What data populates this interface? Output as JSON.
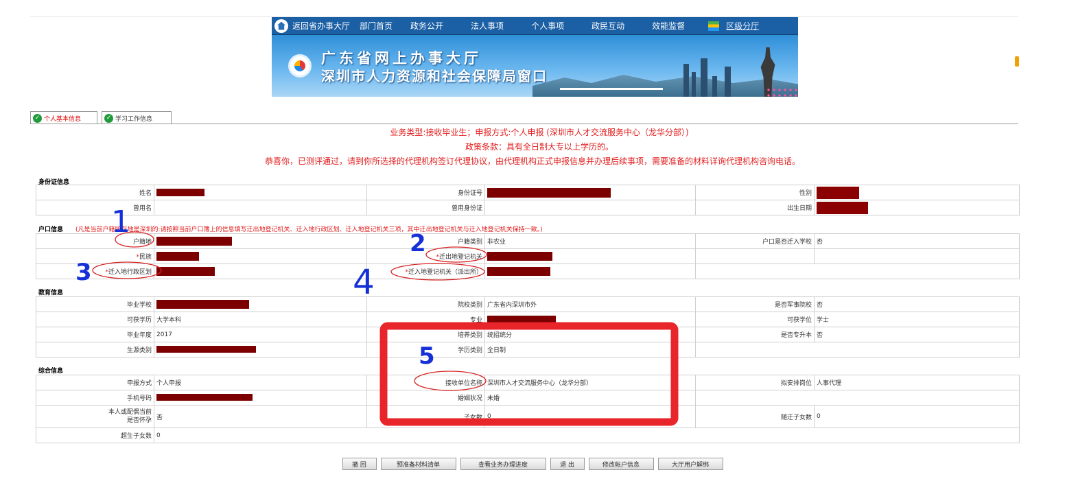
{
  "nav": {
    "items": [
      "返回省办事大厅",
      "部门首页",
      "政务公开",
      "法人事项",
      "个人事项",
      "政民互动",
      "效能监督"
    ],
    "district": "区级分厅"
  },
  "banner": {
    "line1": "广东省网上办事大厅",
    "line2": "深圳市人力资源和社会保障局窗口"
  },
  "tabs": [
    "个人基本信息",
    "学习工作信息"
  ],
  "messages": {
    "line1": "业务类型:接收毕业生；申报方式:个人申报 (深圳市人才交流服务中心（龙华分部）)",
    "line2": "政策条款：具有全日制大专以上学历的。",
    "line3": "恭喜你，已测评通过，请到你所选择的代理机构签订代理协议，由代理机构正式申报信息并办理后续事项，需要准备的材料详询代理机构咨询电话。"
  },
  "sections": {
    "id": "身份证信息",
    "hukou": "户口信息",
    "hukou_note": "(凡是当前户籍所在地是深圳的:请按照当前户口簿上的信息填写迁出地登记机关、迁入地行政区划、迁入地登记机关三项，其中迁出地登记机关与迁入地登记机关保持一致。)",
    "edu": "教育信息",
    "general": "综合信息"
  },
  "id_info": {
    "name_label": "姓名",
    "idno_label": "身份证号",
    "gender_label": "性别",
    "used_name_label": "曾用名",
    "used_id_label": "曾用身份证",
    "birth_label": "出生日期"
  },
  "hukou": {
    "origin_label": "户籍地",
    "type_label": "户籍类别",
    "type_value": "非农业",
    "school_label": "户口是否迁入学校",
    "school_value": "否",
    "ethnic_label": "民族",
    "out_org_label": "迁出地登记机关",
    "in_region_label": "迁入地行政区划",
    "in_org_label": "迁入地登记机关（派出所）",
    "star": "*"
  },
  "edu": {
    "school_label": "毕业学校",
    "school_type_label": "院校类别",
    "school_type_value": "广东省内深圳市外",
    "military_label": "是否军事院校",
    "military_value": "否",
    "degree_label": "可获学历",
    "degree_value": "大学本科",
    "major_label": "专业",
    "title_label": "可获学位",
    "title_value": "学士",
    "year_label": "毕业年度",
    "year_value": "2017",
    "train_label": "培养类别",
    "train_value": "统招统分",
    "upgrade_label": "是否专升本",
    "upgrade_value": "否",
    "source_label": "生源类别",
    "study_label": "学历类别",
    "study_value": "全日制"
  },
  "general": {
    "apply_label": "申报方式",
    "apply_value": "个人申报",
    "unit_label": "接收单位名称",
    "unit_value": "深圳市人才交流服务中心（龙华分部）",
    "post_label": "拟安排岗位",
    "post_value": "人事代理",
    "phone_label": "手机号码",
    "marriage_label": "婚姻状况",
    "marriage_value": "未婚",
    "pregnant_label1": "本人或配偶当前",
    "pregnant_label2": "是否怀孕",
    "pregnant_value": "否",
    "children_label": "子女数",
    "children_value": "0",
    "follow_label": "随迁子女数",
    "follow_value": "0",
    "excess_label": "超生子女数",
    "excess_value": "0"
  },
  "buttons": [
    "撤 回",
    "预准备材料清单",
    "查看业务办理进度",
    "退 出",
    "修改帐户信息",
    "大厅用户解绑"
  ],
  "annotations": [
    "1",
    "2",
    "3",
    "4",
    "5"
  ],
  "colors": {
    "nav_bg": "#1b5fa4",
    "message_red": "#e21c1c",
    "redaction": "#7d0000",
    "highlight_box": "#e8252a",
    "marker_blue": "#1530d6"
  }
}
